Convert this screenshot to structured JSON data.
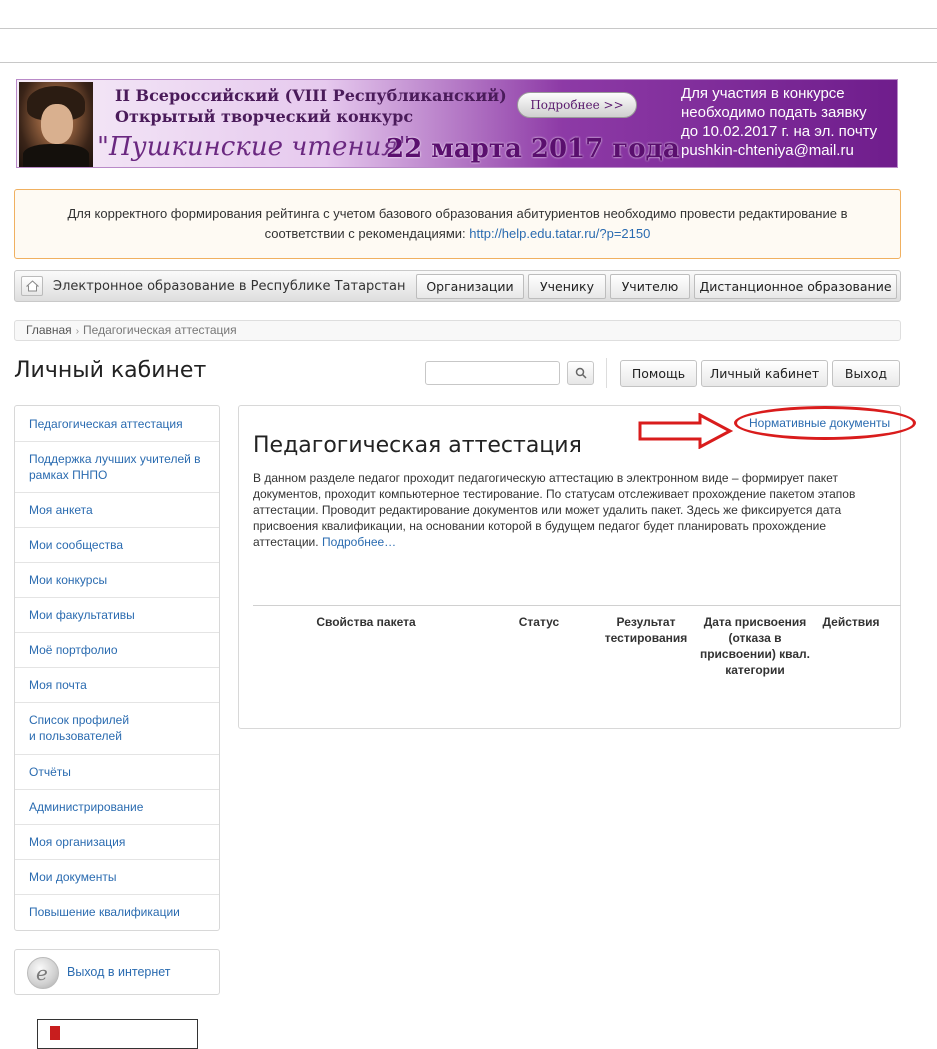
{
  "banner": {
    "line1": "II Всероссийский (VIII Республиканский)",
    "line2": "Открытый творческий конкурс",
    "script_title": "\"Пушкинские чтения\"",
    "date": "22 марта 2017 года",
    "more_button": "Подробнее >>",
    "right_text": [
      "Для участия в конкурсе",
      "необходимо подать заявку",
      "до 10.02.2017 г. на эл. почту",
      "pushkin-chteniya@mail.ru"
    ]
  },
  "notice": {
    "text": "Для корректного формирования рейтинга с учетом базового образования абитуриентов необходимо провести редактирование в соответствии с рекомендациями:",
    "link": "http://help.edu.tatar.ru/?p=2150"
  },
  "navbar": {
    "site_title": "Электронное образование в Республике Татарстан",
    "items": [
      "Организации",
      "Ученику",
      "Учителю",
      "Дистанционное образование"
    ]
  },
  "breadcrumb": {
    "home": "Главная",
    "separator": "›",
    "current": "Педагогическая аттестация"
  },
  "header": {
    "title": "Личный кабинет",
    "search_value": "",
    "buttons": [
      "Помощь",
      "Личный кабинет",
      "Выход"
    ]
  },
  "sidebar": {
    "items": [
      {
        "label": "Педагогическая аттестация"
      },
      {
        "label": "Поддержка лучших учителей в рамках ПНПО"
      },
      {
        "label": "Моя анкета"
      },
      {
        "label": "Мои сообщества"
      },
      {
        "label": "Мои конкурсы"
      },
      {
        "label": "Мои факультативы"
      },
      {
        "label": "Моё портфолио"
      },
      {
        "label": "Моя почта"
      },
      {
        "label": "Список профилей",
        "label2": "и пользователей"
      },
      {
        "label": "Отчёты"
      },
      {
        "label": "Администрирование"
      },
      {
        "label": "Моя организация"
      },
      {
        "label": "Мои документы"
      },
      {
        "label": "Повышение квалификации"
      }
    ],
    "internet_exit": "Выход в интернет"
  },
  "main": {
    "normative_link": "Нормативные документы",
    "title": "Педагогическая аттестация",
    "description": "В данном разделе педагог проходит педагогическую аттестацию в электронном виде – формирует пакет документов, проходит компьютерное тестирование. По статусам отслеживает прохождение пакетом этапов аттестации. Проводит редактирование документов или может удалить пакет. Здесь же фиксируется дата присвоения квалификации, на основании которой в будущем педагог будет планировать прохождение аттестации.",
    "more_link": "Подробнее…",
    "table_headers": [
      "Свойства пакета",
      "Статус",
      "Результат тестирования",
      "Дата присвоения (отказа в присвоении) квал. категории",
      "Действия"
    ]
  },
  "colors": {
    "link": "#2a6bb0",
    "annotation": "#d91c1c",
    "banner_purple": "#6f1d8c",
    "notice_border": "#f0b060"
  }
}
